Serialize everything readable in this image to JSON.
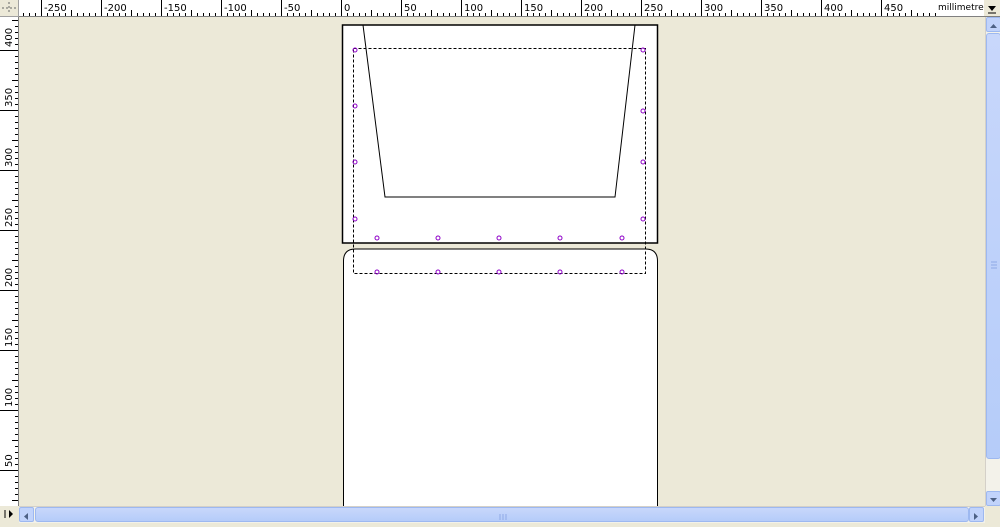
{
  "ruler": {
    "unit": "millimetres",
    "horizontal_labels": [
      "-250",
      "-200",
      "-150",
      "-100",
      "-50",
      "0",
      "50",
      "100",
      "150",
      "200",
      "250",
      "300",
      "350",
      "400",
      "450"
    ],
    "vertical_labels": [
      "400",
      "350",
      "300",
      "250",
      "200",
      "150",
      "100",
      "50"
    ]
  },
  "icons": {
    "corner": "guides-corner-icon",
    "unit_dropdown": "chevron-down-icon",
    "scroll_up": "arrow-up-icon",
    "scroll_down": "arrow-down-icon",
    "scroll_left": "arrow-left-icon",
    "scroll_right": "arrow-right-icon",
    "navigator": "navigator-icon"
  },
  "colors": {
    "canvas_bg": "#ECE9D8",
    "page_bg": "#FFFFFF",
    "point_marker": "#8E00C8",
    "scrollbar": "#C1D3FB"
  }
}
